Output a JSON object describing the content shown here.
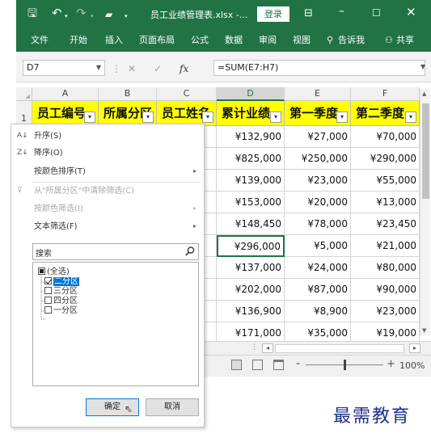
{
  "titlebar": {
    "filename": "员工业绩管理表.xlsx -...",
    "login_label": "登录"
  },
  "ribbon": {
    "tabs": [
      "文件",
      "开始",
      "插入",
      "页面布局",
      "公式",
      "数据",
      "审阅",
      "视图"
    ],
    "tell_me": "告诉我",
    "share": "共享"
  },
  "formula_bar": {
    "name_box": "D7",
    "formula": "=SUM(E7:H7)"
  },
  "sheet": {
    "columns": [
      "A",
      "B",
      "C",
      "D",
      "E",
      "F"
    ],
    "selected_column": "D",
    "row1_label": "1",
    "headers": [
      "员工编号",
      "所属分区",
      "员工姓名",
      "累计业绩",
      "第一季度",
      "第二季度"
    ],
    "rows": [
      [
        "¥132,900",
        "¥27,000",
        "¥70,000"
      ],
      [
        "¥825,000",
        "¥250,000",
        "¥290,000"
      ],
      [
        "¥139,000",
        "¥23,000",
        "¥55,000"
      ],
      [
        "¥153,000",
        "¥20,000",
        "¥13,000"
      ],
      [
        "¥148,450",
        "¥78,000",
        "¥23,450"
      ],
      [
        "¥296,000",
        "¥5,000",
        "¥21,000"
      ],
      [
        "¥137,000",
        "¥24,000",
        "¥80,000"
      ],
      [
        "¥202,000",
        "¥87,000",
        "¥90,000"
      ],
      [
        "¥136,900",
        "¥8,900",
        "¥23,000"
      ],
      [
        "¥171,000",
        "¥35,000",
        "¥19,000"
      ]
    ],
    "active_row_index": 5
  },
  "status": {
    "zoom": "100%"
  },
  "filter_menu": {
    "sort_asc": "升序(S)",
    "sort_desc": "降序(O)",
    "sort_by_color": "按颜色排序(T)",
    "clear_filter": "从\"所属分区\"中清除筛选(C)",
    "filter_by_color": "按颜色筛选(I)",
    "text_filters": "文本筛选(F)",
    "search_placeholder": "搜索",
    "items": [
      {
        "label": "(全选)",
        "state": "partial"
      },
      {
        "label": "二分区",
        "state": "checked"
      },
      {
        "label": "三分区",
        "state": "unchecked"
      },
      {
        "label": "四分区",
        "state": "unchecked"
      },
      {
        "label": "一分区",
        "state": "unchecked"
      }
    ],
    "ok_label": "确定",
    "cancel_label": "取消"
  },
  "watermark": "最需教育",
  "colors": {
    "excel_green": "#217346",
    "header_fill": "#ffff00",
    "selection_blue": "#0078d7"
  }
}
